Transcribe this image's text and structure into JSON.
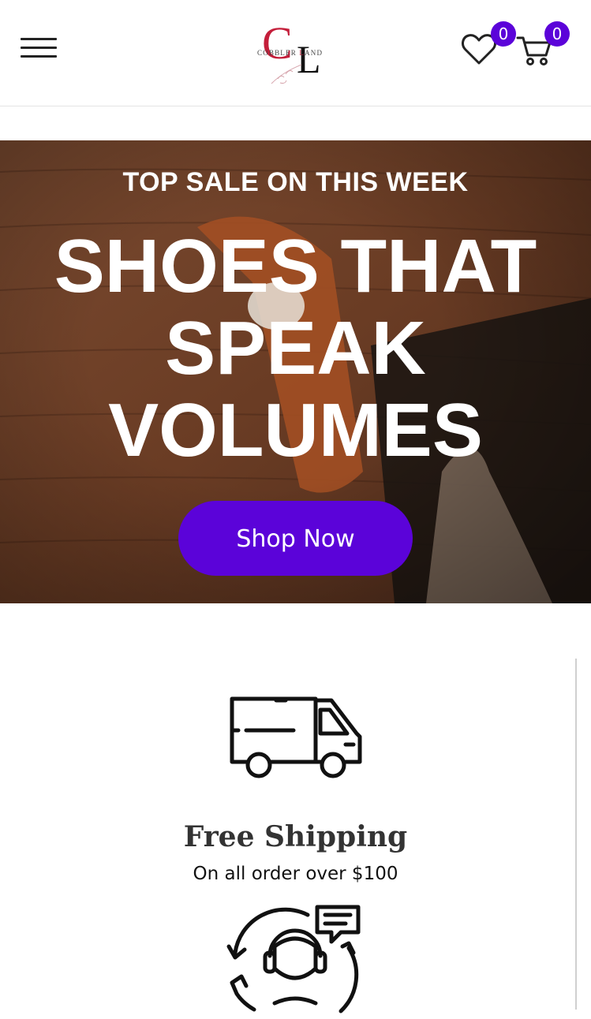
{
  "header": {
    "logo": {
      "letters": "CL",
      "wordmark_left": "COBBLER",
      "wordmark_accent": "L",
      "wordmark_right": "AND"
    },
    "wishlist_count": "0",
    "cart_count": "0",
    "icons": [
      "hamburger-menu-icon",
      "heart-icon",
      "cart-icon"
    ]
  },
  "hero": {
    "eyebrow": "TOP SALE ON THIS WEEK",
    "title": "SHOES THAT SPEAK VOLUMES",
    "cta_label": "Shop Now"
  },
  "features": [
    {
      "icon": "delivery-truck-icon",
      "title": "Free Shipping",
      "subtitle": "On all order over $100"
    },
    {
      "icon": "customer-support-icon"
    }
  ],
  "colors": {
    "accent": "#5b03d9",
    "logo_red": "#c41e3a",
    "hero_wood": "#6b3f26"
  }
}
